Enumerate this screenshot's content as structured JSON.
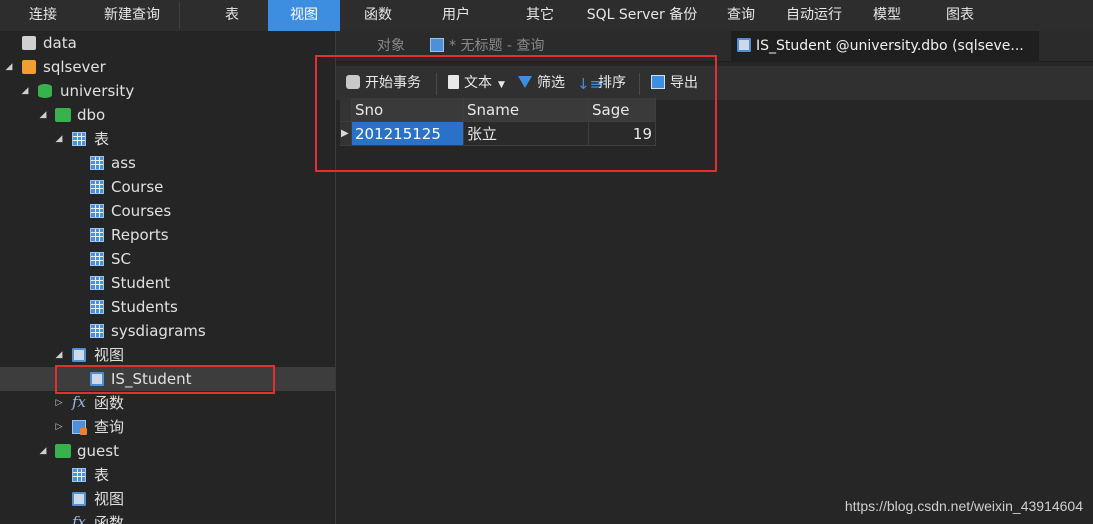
{
  "menu": {
    "items": [
      "连接",
      "新建查询",
      "表",
      "视图",
      "函数",
      "用户",
      "其它",
      "SQL Server 备份",
      "查询",
      "自动运行",
      "模型",
      "图表"
    ],
    "active": "视图"
  },
  "tree": {
    "data": "data",
    "sqlsever": "sqlsever",
    "university": "university",
    "dbo": "dbo",
    "tables_group": "表",
    "tables": [
      "ass",
      "Course",
      "Courses",
      "Reports",
      "SC",
      "Student",
      "Students",
      "sysdiagrams"
    ],
    "views_group": "视图",
    "view_item": "IS_Student",
    "functions_group": "函数",
    "queries_group": "查询",
    "guest": "guest",
    "guest_tables": "表",
    "guest_views": "视图",
    "guest_functions": "函数"
  },
  "tabs": {
    "objects": "对象",
    "untitled": "* 无标题 - 查询",
    "active": "IS_Student @university.dbo (sqlseve..."
  },
  "content_toolbar": {
    "begin_transaction": "开始事务",
    "text": "文本",
    "filter": "筛选",
    "sort": "排序",
    "export": "导出"
  },
  "grid": {
    "columns": [
      "Sno",
      "Sname",
      "Sage"
    ],
    "rows": [
      {
        "Sno": "201215125",
        "Sname": "张立",
        "Sage": "19"
      }
    ]
  },
  "watermark": "https://blog.csdn.net/weixin_43914604",
  "colors": {
    "accent": "#3d8ee0",
    "highlight_box": "#e03030",
    "selected_cell": "#2a72c8"
  }
}
